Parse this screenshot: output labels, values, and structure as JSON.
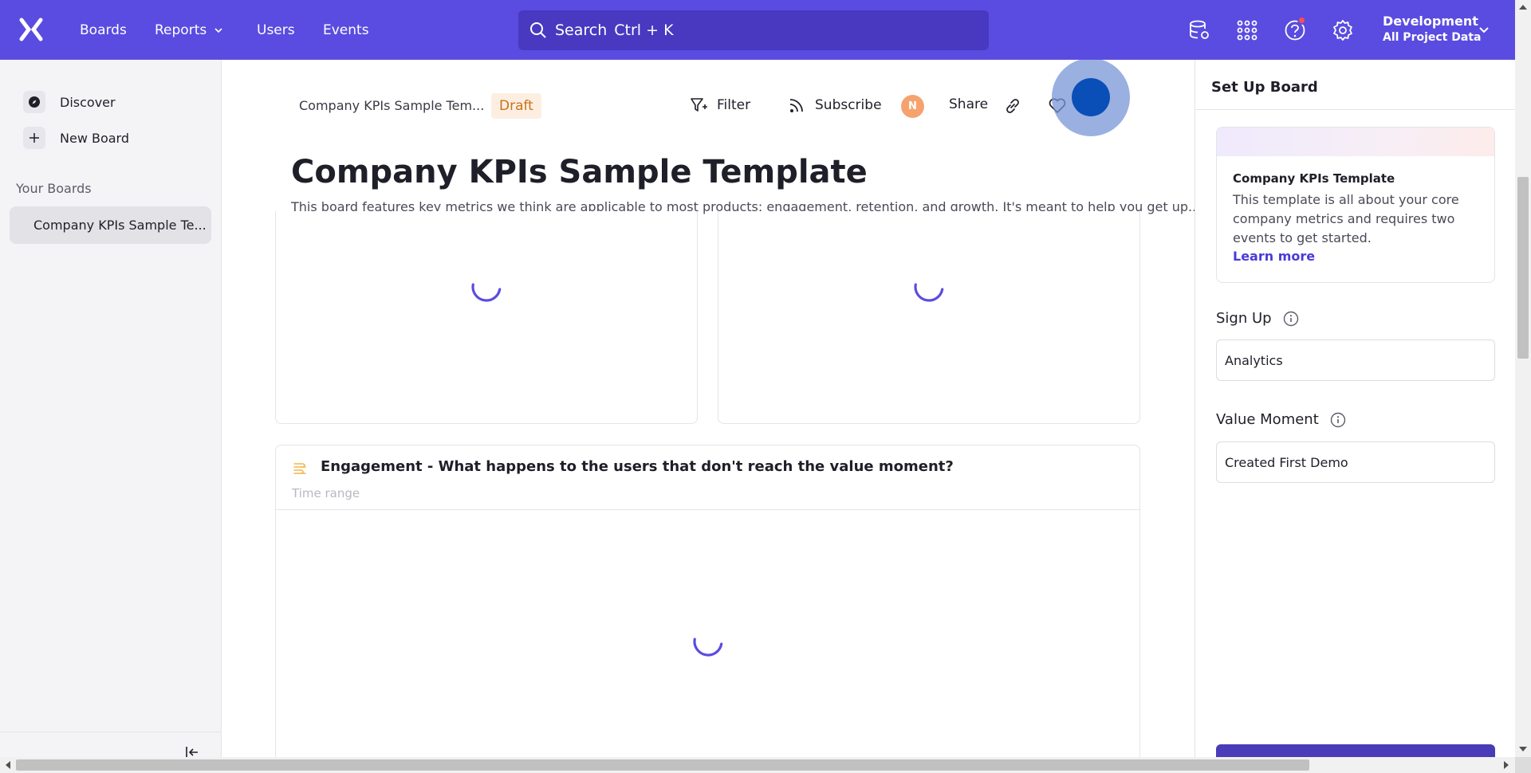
{
  "nav": {
    "logo": "mixpanel-logo",
    "links": [
      "Boards",
      "Reports",
      "Users",
      "Events"
    ],
    "search_label": "Search",
    "search_shortcut": "Ctrl + K",
    "project_name": "Development",
    "project_scope": "All Project Data"
  },
  "sidebar": {
    "items": [
      {
        "label": "Discover",
        "icon": "compass-icon"
      },
      {
        "label": "New Board",
        "icon": "plus-icon"
      }
    ],
    "section_heading": "Your Boards",
    "boards": [
      "Company KPIs Sample Te..."
    ]
  },
  "board": {
    "breadcrumb": "Company KPIs Sample Tem...",
    "status": "Draft",
    "toolbar": {
      "filter": "Filter",
      "subscribe": "Subscribe",
      "avatar_initial": "N",
      "share": "Share"
    },
    "title": "Company KPIs Sample Template",
    "description": "This board features key metrics we think are applicable to most products: engagement, retention, and growth. It's meant to help you get up..."
  },
  "cards": {
    "engagement_title": "Engagement - What happens to the users that don't reach the value moment?",
    "engagement_subtitle": "Time range"
  },
  "setup_panel": {
    "title": "Set Up Board",
    "template_name": "Company KPIs Template",
    "template_text": "This template is all about your core company metrics and requires two events to get started.",
    "learn_more": "Learn more",
    "signup_label": "Sign Up",
    "signup_value": "Analytics",
    "value_moment_label": "Value Moment",
    "value_moment_value": "Created First Demo"
  },
  "colors": {
    "brand": "#5a4ce0",
    "accent_link": "#4a3bd6",
    "draft_bg": "#fcefe2",
    "draft_text": "#c9721c",
    "spinner": "#5a4ce0"
  }
}
